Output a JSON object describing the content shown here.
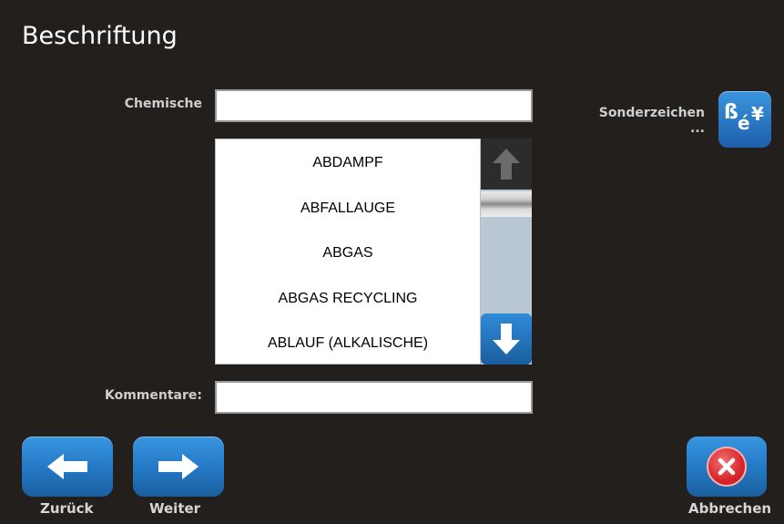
{
  "header": {
    "title": "Beschriftung"
  },
  "form": {
    "chemische_label": "Chemische",
    "chemische_value": "",
    "kommentare_label": "Kommentare:",
    "kommentare_value": ""
  },
  "list": {
    "items": [
      "ABDAMPF",
      "ABFALLAUGE",
      "ABGAS",
      "ABGAS RECYCLING",
      "ABLAUF (ALKALISCHE)"
    ]
  },
  "special_chars": {
    "label_line1": "Sonderzeichen",
    "label_line2": "...",
    "icon_text_b": "ß",
    "icon_text_e": "é",
    "icon_text_y": "¥"
  },
  "footer": {
    "back_label": "Zurück",
    "next_label": "Weiter",
    "cancel_label": "Abbrechen"
  },
  "icons": {
    "scroll_up": "arrow-up-icon",
    "scroll_down": "arrow-down-icon",
    "back": "arrow-left-icon",
    "next": "arrow-right-icon",
    "cancel": "close-icon"
  },
  "colors": {
    "background": "#231f1d",
    "button_blue": "#2377c3",
    "cancel_red": "#d8262b",
    "scrollbar_track": "#b9c6d4"
  }
}
